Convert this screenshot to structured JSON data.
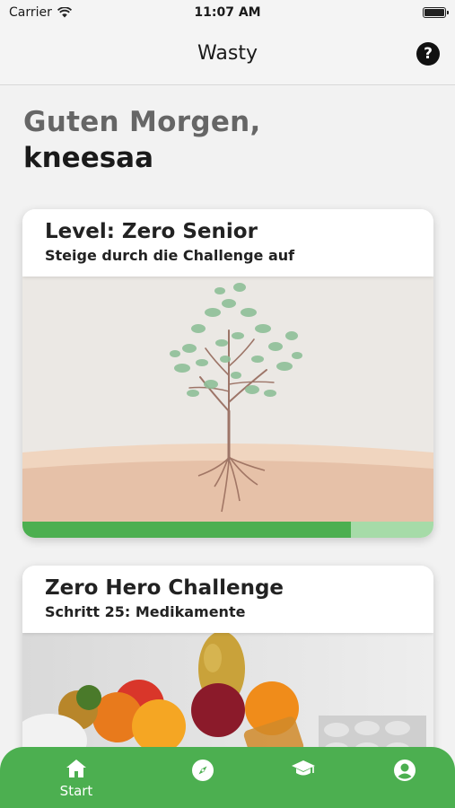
{
  "status_bar": {
    "carrier": "Carrier",
    "time": "11:07 AM"
  },
  "nav": {
    "title": "Wasty",
    "help_icon": "question-circle-icon"
  },
  "greeting": {
    "line1": "Guten Morgen,",
    "name": "kneesaa"
  },
  "level_card": {
    "title": "Level: Zero Senior",
    "subtitle": "Steige durch die Challenge auf",
    "progress": 0.8
  },
  "challenge_card": {
    "title": "Zero Hero Challenge",
    "subtitle": "Schritt 25: Medikamente"
  },
  "tabs": [
    {
      "label": "Start",
      "icon": "home-icon",
      "active": true
    },
    {
      "label": "",
      "icon": "compass-icon"
    },
    {
      "label": "",
      "icon": "graduation-cap-icon"
    },
    {
      "label": "",
      "icon": "account-icon"
    }
  ],
  "colors": {
    "accent": "#4caf50",
    "progress_track": "#a6dba8"
  }
}
